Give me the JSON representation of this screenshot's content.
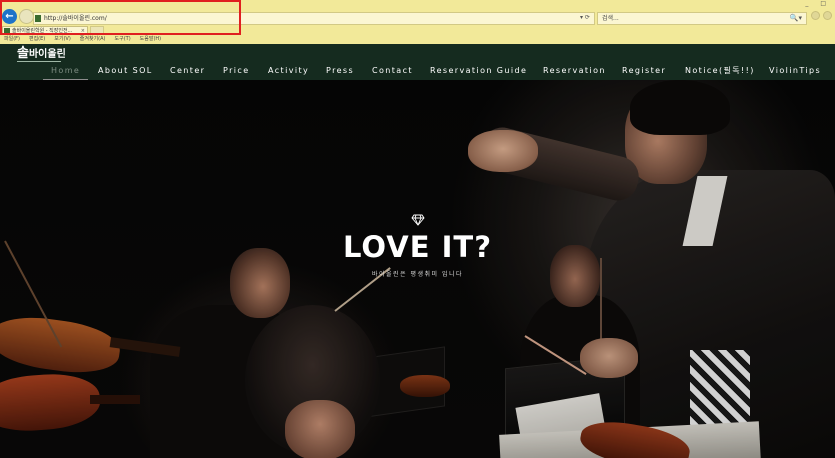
{
  "browser": {
    "back_label": "←",
    "address": "http://솔바이올린.com/",
    "address_actions": "▾ ⟳",
    "search_placeholder": "검색...",
    "search_icon": "🔍▾",
    "tab_title": "솔바이올린학원 - 직장인전...",
    "tab_close": "×",
    "window_controls": "_ □",
    "menu": [
      "파일(F)",
      "편집(E)",
      "보기(V)",
      "즐겨찾기(A)",
      "도구(T)",
      "도움말(H)"
    ]
  },
  "site": {
    "logo_text": "바이올린",
    "logo_mark": "솔",
    "nav": [
      {
        "label": "Home",
        "active": true
      },
      {
        "label": "About SOL"
      },
      {
        "label": "Center"
      },
      {
        "label": "Price"
      },
      {
        "label": "Activity"
      },
      {
        "label": "Press"
      },
      {
        "label": "Contact"
      },
      {
        "label": "Reservation Guide"
      },
      {
        "label": "Reservation"
      },
      {
        "label": "Register"
      },
      {
        "label": "Notice(필독!!)"
      },
      {
        "label": "ViolinTips"
      }
    ]
  },
  "hero": {
    "title": "LOVE IT?",
    "subtitle": "바이올린은 평생취미 입니다"
  },
  "colors": {
    "chrome_bg": "#f2e999",
    "site_header_bg": "#152b1f",
    "highlight_border": "#e01f1f"
  }
}
